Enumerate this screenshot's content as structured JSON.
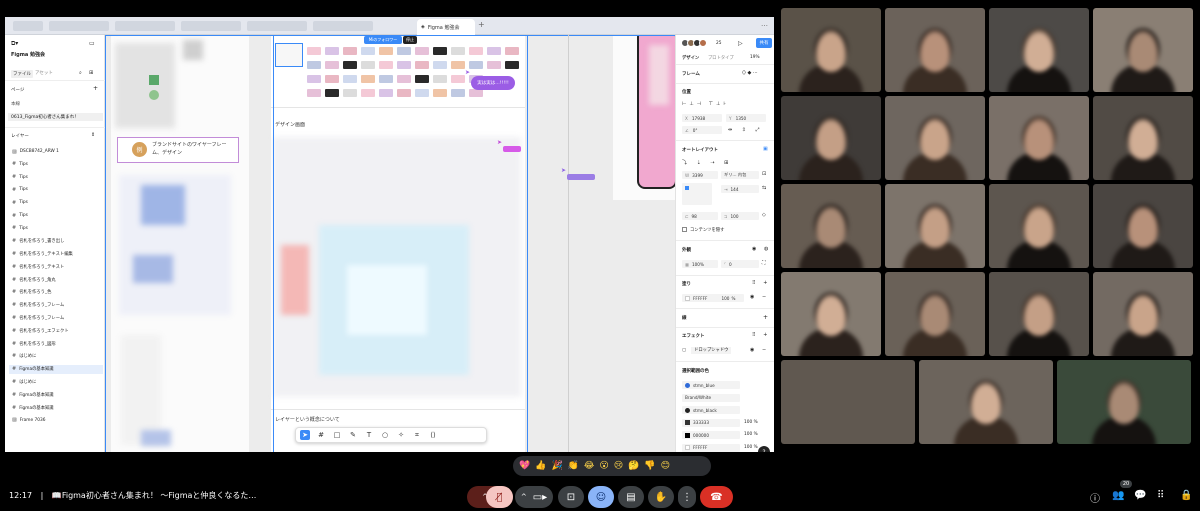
{
  "screen": {
    "active_tab": "Figma 勉強会",
    "add_tab": "+",
    "menu": "…",
    "left_panel": {
      "file_name": "Figma 勉強会",
      "tab_file": "ファイル",
      "tab_assets": "アセット",
      "pages_label": "ページ",
      "pages_add": "+",
      "page_section": "本線",
      "current_page": "0613_Figma初心者さん集まれ！",
      "layers_label": "レイヤー",
      "layers": [
        {
          "label": "DSCB8742_ARW 1",
          "icon": "image"
        },
        {
          "label": "Tips",
          "icon": "frame"
        },
        {
          "label": "Tips",
          "icon": "frame"
        },
        {
          "label": "Tips",
          "icon": "frame"
        },
        {
          "label": "Tips",
          "icon": "frame"
        },
        {
          "label": "Tips",
          "icon": "frame"
        },
        {
          "label": "Tips",
          "icon": "frame"
        },
        {
          "label": "名札を作ろう_書き出し",
          "icon": "frame"
        },
        {
          "label": "名札を作ろう_テキスト編集",
          "icon": "frame"
        },
        {
          "label": "名札を作ろう_テキスト",
          "icon": "frame"
        },
        {
          "label": "名札を作ろう_角丸",
          "icon": "frame"
        },
        {
          "label": "名札を作ろう_色",
          "icon": "frame"
        },
        {
          "label": "名札を作ろう_フレーム",
          "icon": "frame"
        },
        {
          "label": "名札を作ろう_フレーム",
          "icon": "frame"
        },
        {
          "label": "名札を作ろう_エフェクト",
          "icon": "frame"
        },
        {
          "label": "名札を作ろう_図形",
          "icon": "frame"
        },
        {
          "label": "はじめに",
          "icon": "frame"
        },
        {
          "label": "Figmaの基本知識",
          "icon": "frame",
          "selected": true
        },
        {
          "label": "はじめに",
          "icon": "frame"
        },
        {
          "label": "Figmaの基本知識",
          "icon": "frame"
        },
        {
          "label": "Figmaの基本知識",
          "icon": "frame"
        },
        {
          "label": "Frame 7036",
          "icon": "image"
        }
      ]
    },
    "canvas": {
      "follow_chip": "Miのフォロワー",
      "stop_chip": "停止",
      "speech_bubble": "実は実は…!!!!!",
      "example_badge": "例",
      "example_text_1": "ブランドサイトのワイヤーフレー",
      "example_text_2": "ム、デザイン",
      "section_design": "デザイン画面",
      "section_layers": "レイヤーという概念について"
    },
    "right_panel": {
      "share_button": "共有",
      "zoom_label": "25",
      "tab_design": "デザイン",
      "tab_prototype": "プロトタイプ",
      "zoom_percent": "19%",
      "frame_label": "フレーム",
      "position_label": "位置",
      "x_value": "17938",
      "y_value": "1350",
      "rotation_value": "0°",
      "auto_layout_label": "オートレイアウト",
      "width_value": "3399",
      "width_mode": "ギリ… 内包",
      "gap_value": "144",
      "padding_left": "98",
      "padding_right": "100",
      "clip_label": "コンテンツを隠す",
      "appearance_label": "外観",
      "opacity_value": "100%",
      "radius_value": "0",
      "fill_label": "塗り",
      "fill_hex": "FFFFFF",
      "fill_opacity": "100",
      "stroke_label": "線",
      "effects_label": "エフェクト",
      "effect_value": "ドロップシャドウ",
      "selection_colors_label": "選択範囲の色",
      "selection_colors": [
        {
          "name": "stmn_blue",
          "color": "#2f6bd8",
          "shape": "circle"
        },
        {
          "name": "Brand/White",
          "color": "#ffffff",
          "shape": "none"
        },
        {
          "name": "stmn_black",
          "color": "#222222",
          "shape": "circle"
        },
        {
          "name": "333333",
          "color": "#333333",
          "shape": "square",
          "opacity": "100"
        },
        {
          "name": "000000",
          "color": "#000000",
          "shape": "square",
          "opacity": "100"
        },
        {
          "name": "FFFFFF",
          "color": "#ffffff",
          "shape": "square",
          "opacity": "100"
        }
      ],
      "help": "?"
    }
  },
  "meet": {
    "time": "12:17",
    "separator": "|",
    "meeting_title": "📖Figma初心者さん集まれ！ ～Figmaと仲良くなるた…",
    "reactions": [
      "💖",
      "👍",
      "🎉",
      "👏",
      "😂",
      "😮",
      "😢",
      "🤔",
      "👎",
      "😊"
    ],
    "participant_count": "20",
    "colors": {
      "end_call": "#d93025",
      "muted_mic": "#f5c6c2",
      "emoji_button": "#8ab4f8",
      "control": "#3c4043"
    }
  }
}
